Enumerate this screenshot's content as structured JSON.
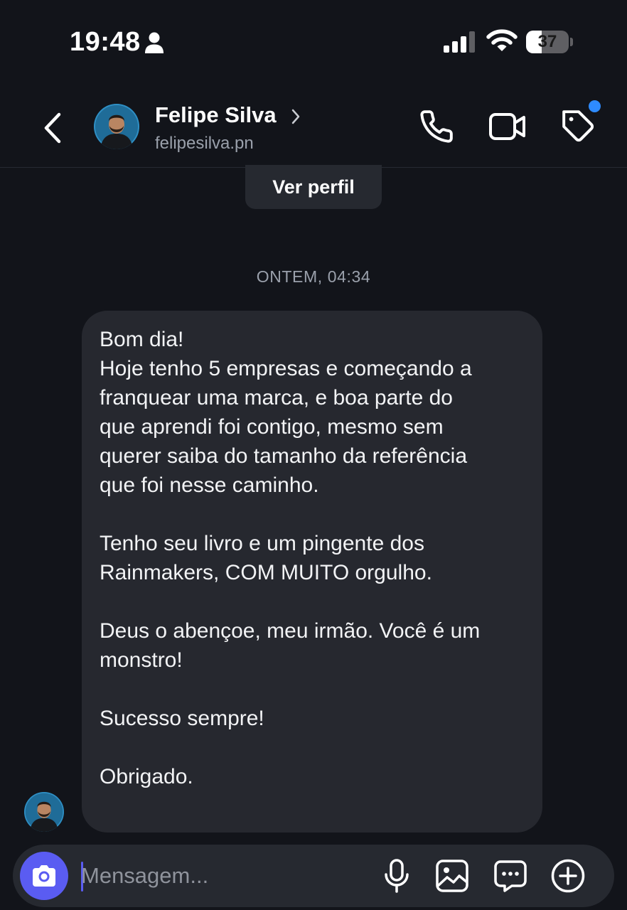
{
  "status_bar": {
    "time": "19:48",
    "battery": 37
  },
  "header": {
    "contact_name": "Felipe Silva",
    "contact_handle": "felipesilva.pn",
    "has_notification_dot": true,
    "notification_color": "#2e8bff"
  },
  "chat": {
    "view_profile_label": "Ver perfil",
    "timestamp": "ONTEM, 04:34",
    "messages": [
      {
        "sender": "Felipe Silva",
        "text": "Bom dia!\nHoje tenho 5 empresas e começando a\nfranquear uma marca, e boa parte do\nque aprendi foi contigo, mesmo sem\nquerer saiba do tamanho da referência\nque foi nesse caminho.\n\nTenho seu livro e um pingente dos\nRainmakers, COM MUITO orgulho.\n\nDeus o abençoe, meu irmão. Você é um\nmonstro!\n\nSucesso sempre!\n\nObrigado."
      }
    ]
  },
  "composer": {
    "placeholder": "Mensagem...",
    "accent_color": "#5a5cf2",
    "icons": [
      "camera-icon",
      "microphone-icon",
      "image-icon",
      "sticker-chat-icon",
      "plus-circle-icon"
    ]
  }
}
